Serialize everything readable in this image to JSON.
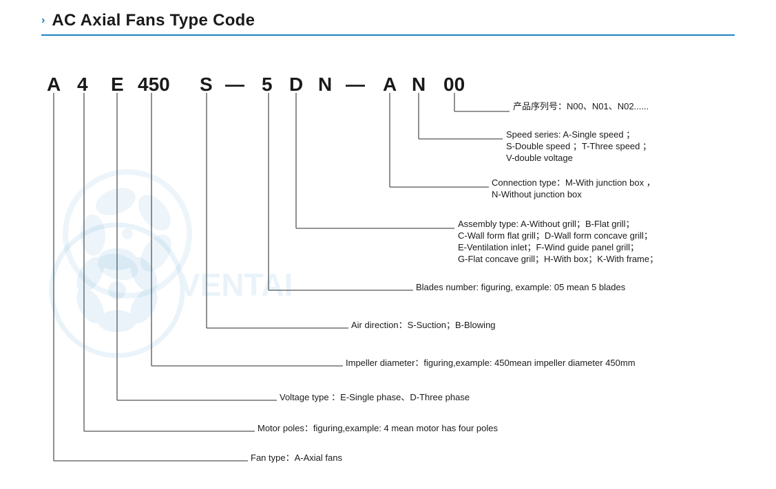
{
  "header": {
    "chevron": "›",
    "title": "AC Axial Fans Type Code",
    "divider_color": "#1a82c4"
  },
  "type_code": {
    "letters": [
      "A",
      "4",
      "E",
      "450",
      "S",
      "—",
      "5",
      "D",
      "N",
      "—",
      "A",
      "N",
      "00"
    ]
  },
  "annotations": [
    {
      "id": "product_series",
      "text_cn": "产品序列号：N00、N01、N02......",
      "text_en": ""
    },
    {
      "id": "speed_series",
      "line1": "Speed series:  A-Single speed ；",
      "line2": "S-Double speed ；T-Three speed ；",
      "line3": "V-double voltage"
    },
    {
      "id": "connection_type",
      "line1": "Connection type：M-With junction box ，",
      "line2": "N-Without junction box"
    },
    {
      "id": "assembly_type",
      "line1": "Assembly type:  A-Without grill；B-Flat grill；",
      "line2": "C-Wall form flat grill；D-Wall form concave grill；",
      "line3": "E-Ventilation inlet；F-Wind guide panel grill；",
      "line4": "G-Flat concave grill；H-With box；K-With frame；"
    },
    {
      "id": "blades_number",
      "text": "Blades number: figuring, example: 05 mean 5 blades"
    },
    {
      "id": "air_direction",
      "text": "Air direction：S-Suction；B-Blowing"
    },
    {
      "id": "impeller_diameter",
      "text": "Impeller diameter：figuring,example: 450mean impeller diameter 450mm"
    },
    {
      "id": "voltage_type",
      "text": "Voltage type ：E-Single phase、D-Three phase"
    },
    {
      "id": "motor_poles",
      "text": "Motor poles：figuring,example: 4 mean motor has four poles"
    },
    {
      "id": "fan_type",
      "text": "Fan type：A-Axial fans"
    }
  ],
  "watermark": {
    "text": "VENTAI"
  }
}
